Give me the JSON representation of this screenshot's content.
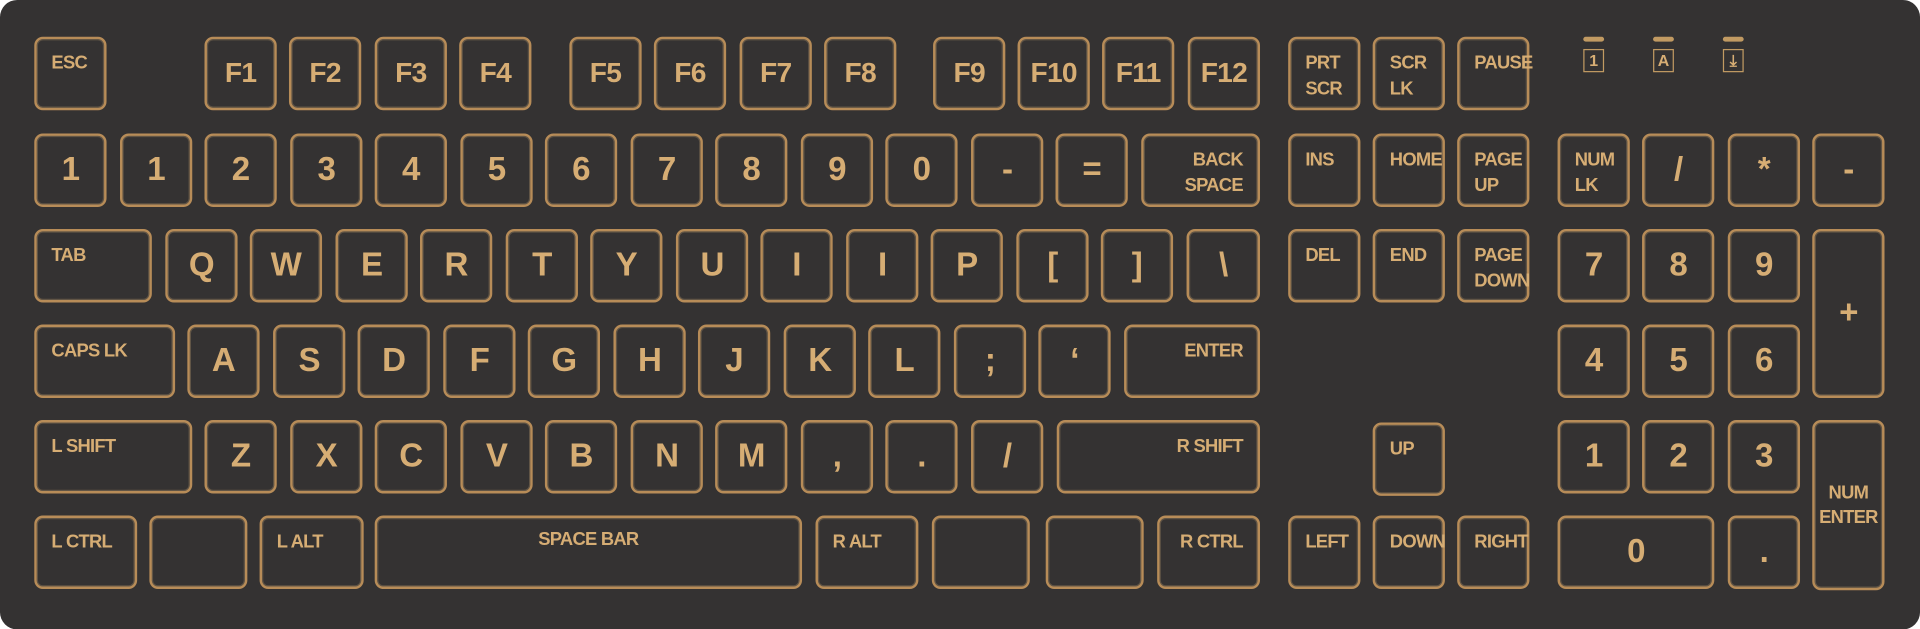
{
  "keyboard": {
    "colors": {
      "body": "#343232",
      "accent": "#d6ad74",
      "border": "#b78c58"
    },
    "indicators": [
      {
        "name": "num-lock-indicator",
        "glyph": "1"
      },
      {
        "name": "caps-lock-indicator",
        "glyph": "A"
      },
      {
        "name": "scroll-lock-indicator",
        "glyph": "⤓"
      }
    ],
    "keys": [
      "ESC",
      "F1",
      "F2",
      "F3",
      "F4",
      "F5",
      "F6",
      "F7",
      "F8",
      "F9",
      "F10",
      "F11",
      "F12",
      "PRT\nSCR",
      "SCR\nLK",
      "PAUSE",
      "1",
      "1",
      "2",
      "3",
      "4",
      "5",
      "6",
      "7",
      "8",
      "9",
      "0",
      "-",
      "=",
      "BACK\nSPACE",
      "INS",
      "HOME",
      "PAGE\nUP",
      "NUM\nLK",
      "/",
      "*",
      "-",
      "TAB",
      "Q",
      "W",
      "E",
      "R",
      "T",
      "Y",
      "U",
      "I",
      "I",
      "P",
      "[",
      "]",
      "\\",
      "DEL",
      "END",
      "PAGE\nDOWN",
      "7",
      "8",
      "9",
      "+",
      "CAPS LK",
      "A",
      "S",
      "D",
      "F",
      "G",
      "H",
      "J",
      "K",
      "L",
      ";",
      "‘",
      "ENTER",
      "4",
      "5",
      "6",
      "L SHIFT",
      "Z",
      "X",
      "C",
      "V",
      "B",
      "N",
      "M",
      ",",
      ".",
      "/",
      "R SHIFT",
      "UP",
      "1",
      "2",
      "3",
      "NUM\nENTER",
      "L CTRL",
      "",
      "L ALT",
      "SPACE BAR",
      "R ALT",
      "",
      "",
      "R CTRL",
      "LEFT",
      "DOWN",
      "RIGHT",
      "0",
      "."
    ]
  }
}
